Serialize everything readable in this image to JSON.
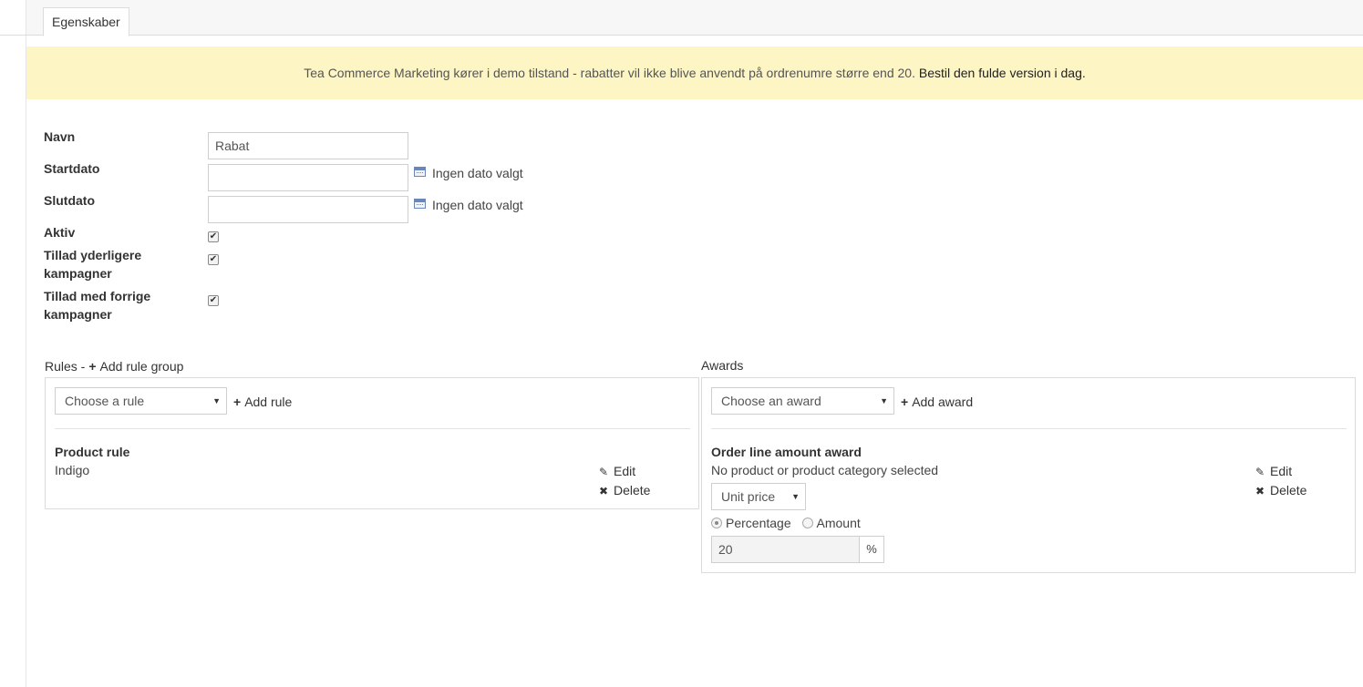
{
  "tabs": [
    {
      "label": "Egenskaber",
      "active": true
    }
  ],
  "banner": {
    "text": "Tea Commerce Marketing kører i demo tilstand - rabatter vil ikke blive anvendt på ordrenumre større end 20.",
    "link": "Bestil den fulde version i dag."
  },
  "form": {
    "name": {
      "label": "Navn",
      "value": "Rabat"
    },
    "start_date": {
      "label": "Startdato",
      "value": "",
      "status": "Ingen dato valgt"
    },
    "end_date": {
      "label": "Slutdato",
      "value": "",
      "status": "Ingen dato valgt"
    },
    "active": {
      "label": "Aktiv",
      "checked": true
    },
    "allow_additional": {
      "label": "Tillad yderligere kampagner",
      "checked": true
    },
    "allow_previous": {
      "label": "Tillad med forrige kampagner",
      "checked": true
    }
  },
  "rules": {
    "title": "Rules -",
    "add_group": "Add rule group",
    "select_placeholder": "Choose a rule",
    "add_rule": "Add rule",
    "items": [
      {
        "title": "Product rule",
        "detail": "Indigo",
        "edit": "Edit",
        "delete": "Delete"
      }
    ]
  },
  "awards": {
    "title": "Awards",
    "select_placeholder": "Choose an award",
    "add_award": "Add award",
    "items": [
      {
        "title": "Order line amount award",
        "detail": "No product or product category selected",
        "price_type": "Unit price",
        "radio_percentage": "Percentage",
        "radio_amount": "Amount",
        "selected": "Percentage",
        "value": "20",
        "unit": "%",
        "edit": "Edit",
        "delete": "Delete"
      }
    ]
  },
  "icons": {
    "check": "✔",
    "plus": "+",
    "edit": "pencil-icon",
    "delete": "x-icon",
    "calendar": "calendar-icon"
  }
}
